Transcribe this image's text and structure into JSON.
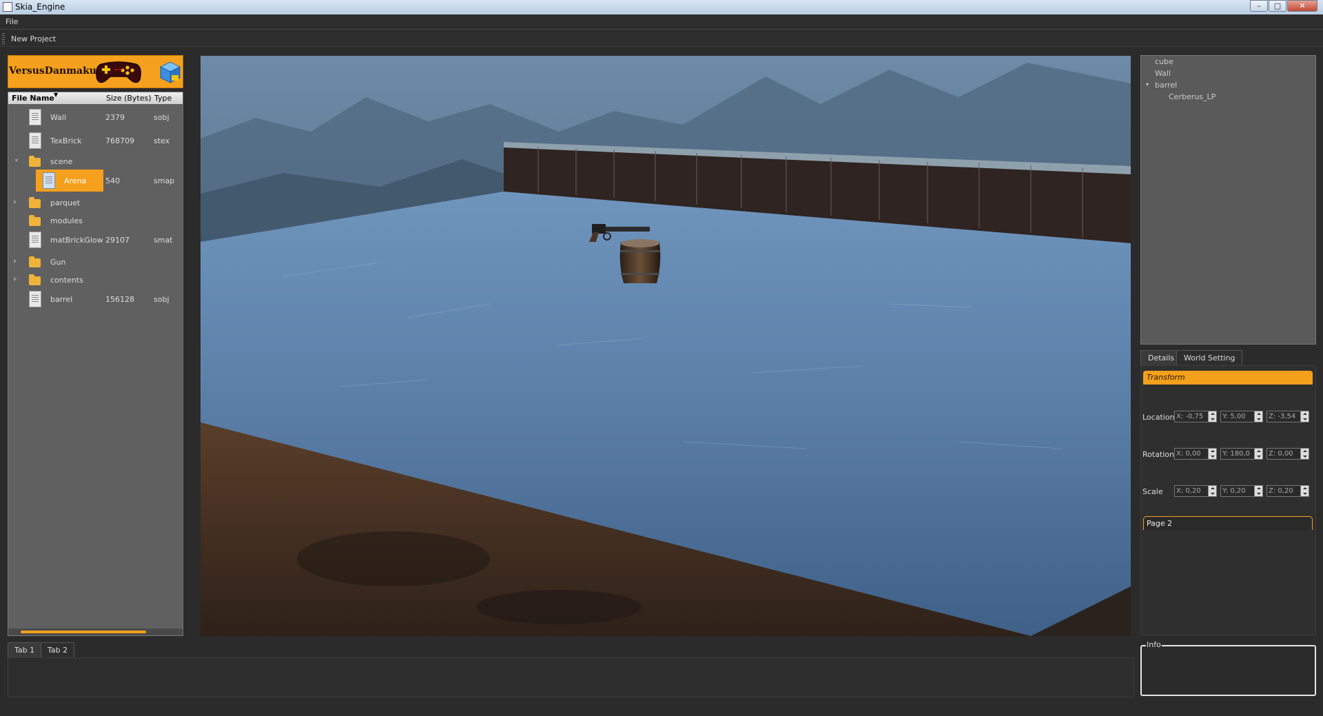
{
  "window": {
    "title": "Skia_Engine",
    "minimize": "–",
    "maximize": "□",
    "close": "✕"
  },
  "menu": {
    "file": "File"
  },
  "toolbar": {
    "new_project": "New Project"
  },
  "banner": {
    "title": "VersusDanmaku"
  },
  "file_browser": {
    "columns": {
      "name": "File Name",
      "size": "Size (Bytes)",
      "type": "Type"
    },
    "rows": [
      {
        "name": "Wall",
        "size": "2379",
        "type": "sobj",
        "icon": "file-icon"
      },
      {
        "name": "TexBrick",
        "size": "768709",
        "type": "stex",
        "icon": "file-icon"
      },
      {
        "name": "scene",
        "size": "",
        "type": "",
        "icon": "folder-icon"
      },
      {
        "name": "Arena",
        "size": "540",
        "type": "smap",
        "icon": "file-icon"
      },
      {
        "name": "parquet",
        "size": "",
        "type": "",
        "icon": "folder-icon"
      },
      {
        "name": "modules",
        "size": "",
        "type": "",
        "icon": "folder-icon"
      },
      {
        "name": "matBrickGlow",
        "size": "29107",
        "type": "smat",
        "icon": "file-icon"
      },
      {
        "name": "Gun",
        "size": "",
        "type": "",
        "icon": "folder-icon"
      },
      {
        "name": "contents",
        "size": "",
        "type": "",
        "icon": "folder-icon"
      },
      {
        "name": "barrel",
        "size": "156128",
        "type": "sobj",
        "icon": "file-icon"
      }
    ]
  },
  "scene_tree": {
    "nodes": [
      "cube",
      "Wall",
      "barrel",
      "Cerberus_LP"
    ]
  },
  "details": {
    "tabs": [
      "Details",
      "World Setting"
    ],
    "section": "Transform",
    "location": {
      "label": "Location",
      "x": "X: -0,75",
      "y": "Y: 5,00",
      "z": "Z: -3,54"
    },
    "rotation": {
      "label": "Rotation",
      "x": "X: 0,00",
      "y": "Y: 180,0",
      "z": "Z: 0,00"
    },
    "scale": {
      "label": "Scale",
      "x": "X: 0,20",
      "y": "Y: 0,20",
      "z": "Z: 0,20"
    },
    "page2": "Page 2"
  },
  "bottom": {
    "tabs": [
      "Tab 1",
      "Tab 2"
    ],
    "info_label": "Info"
  },
  "colors": {
    "accent": "#f5a01c",
    "background": "#2b2b2b",
    "panel": "#606060"
  }
}
